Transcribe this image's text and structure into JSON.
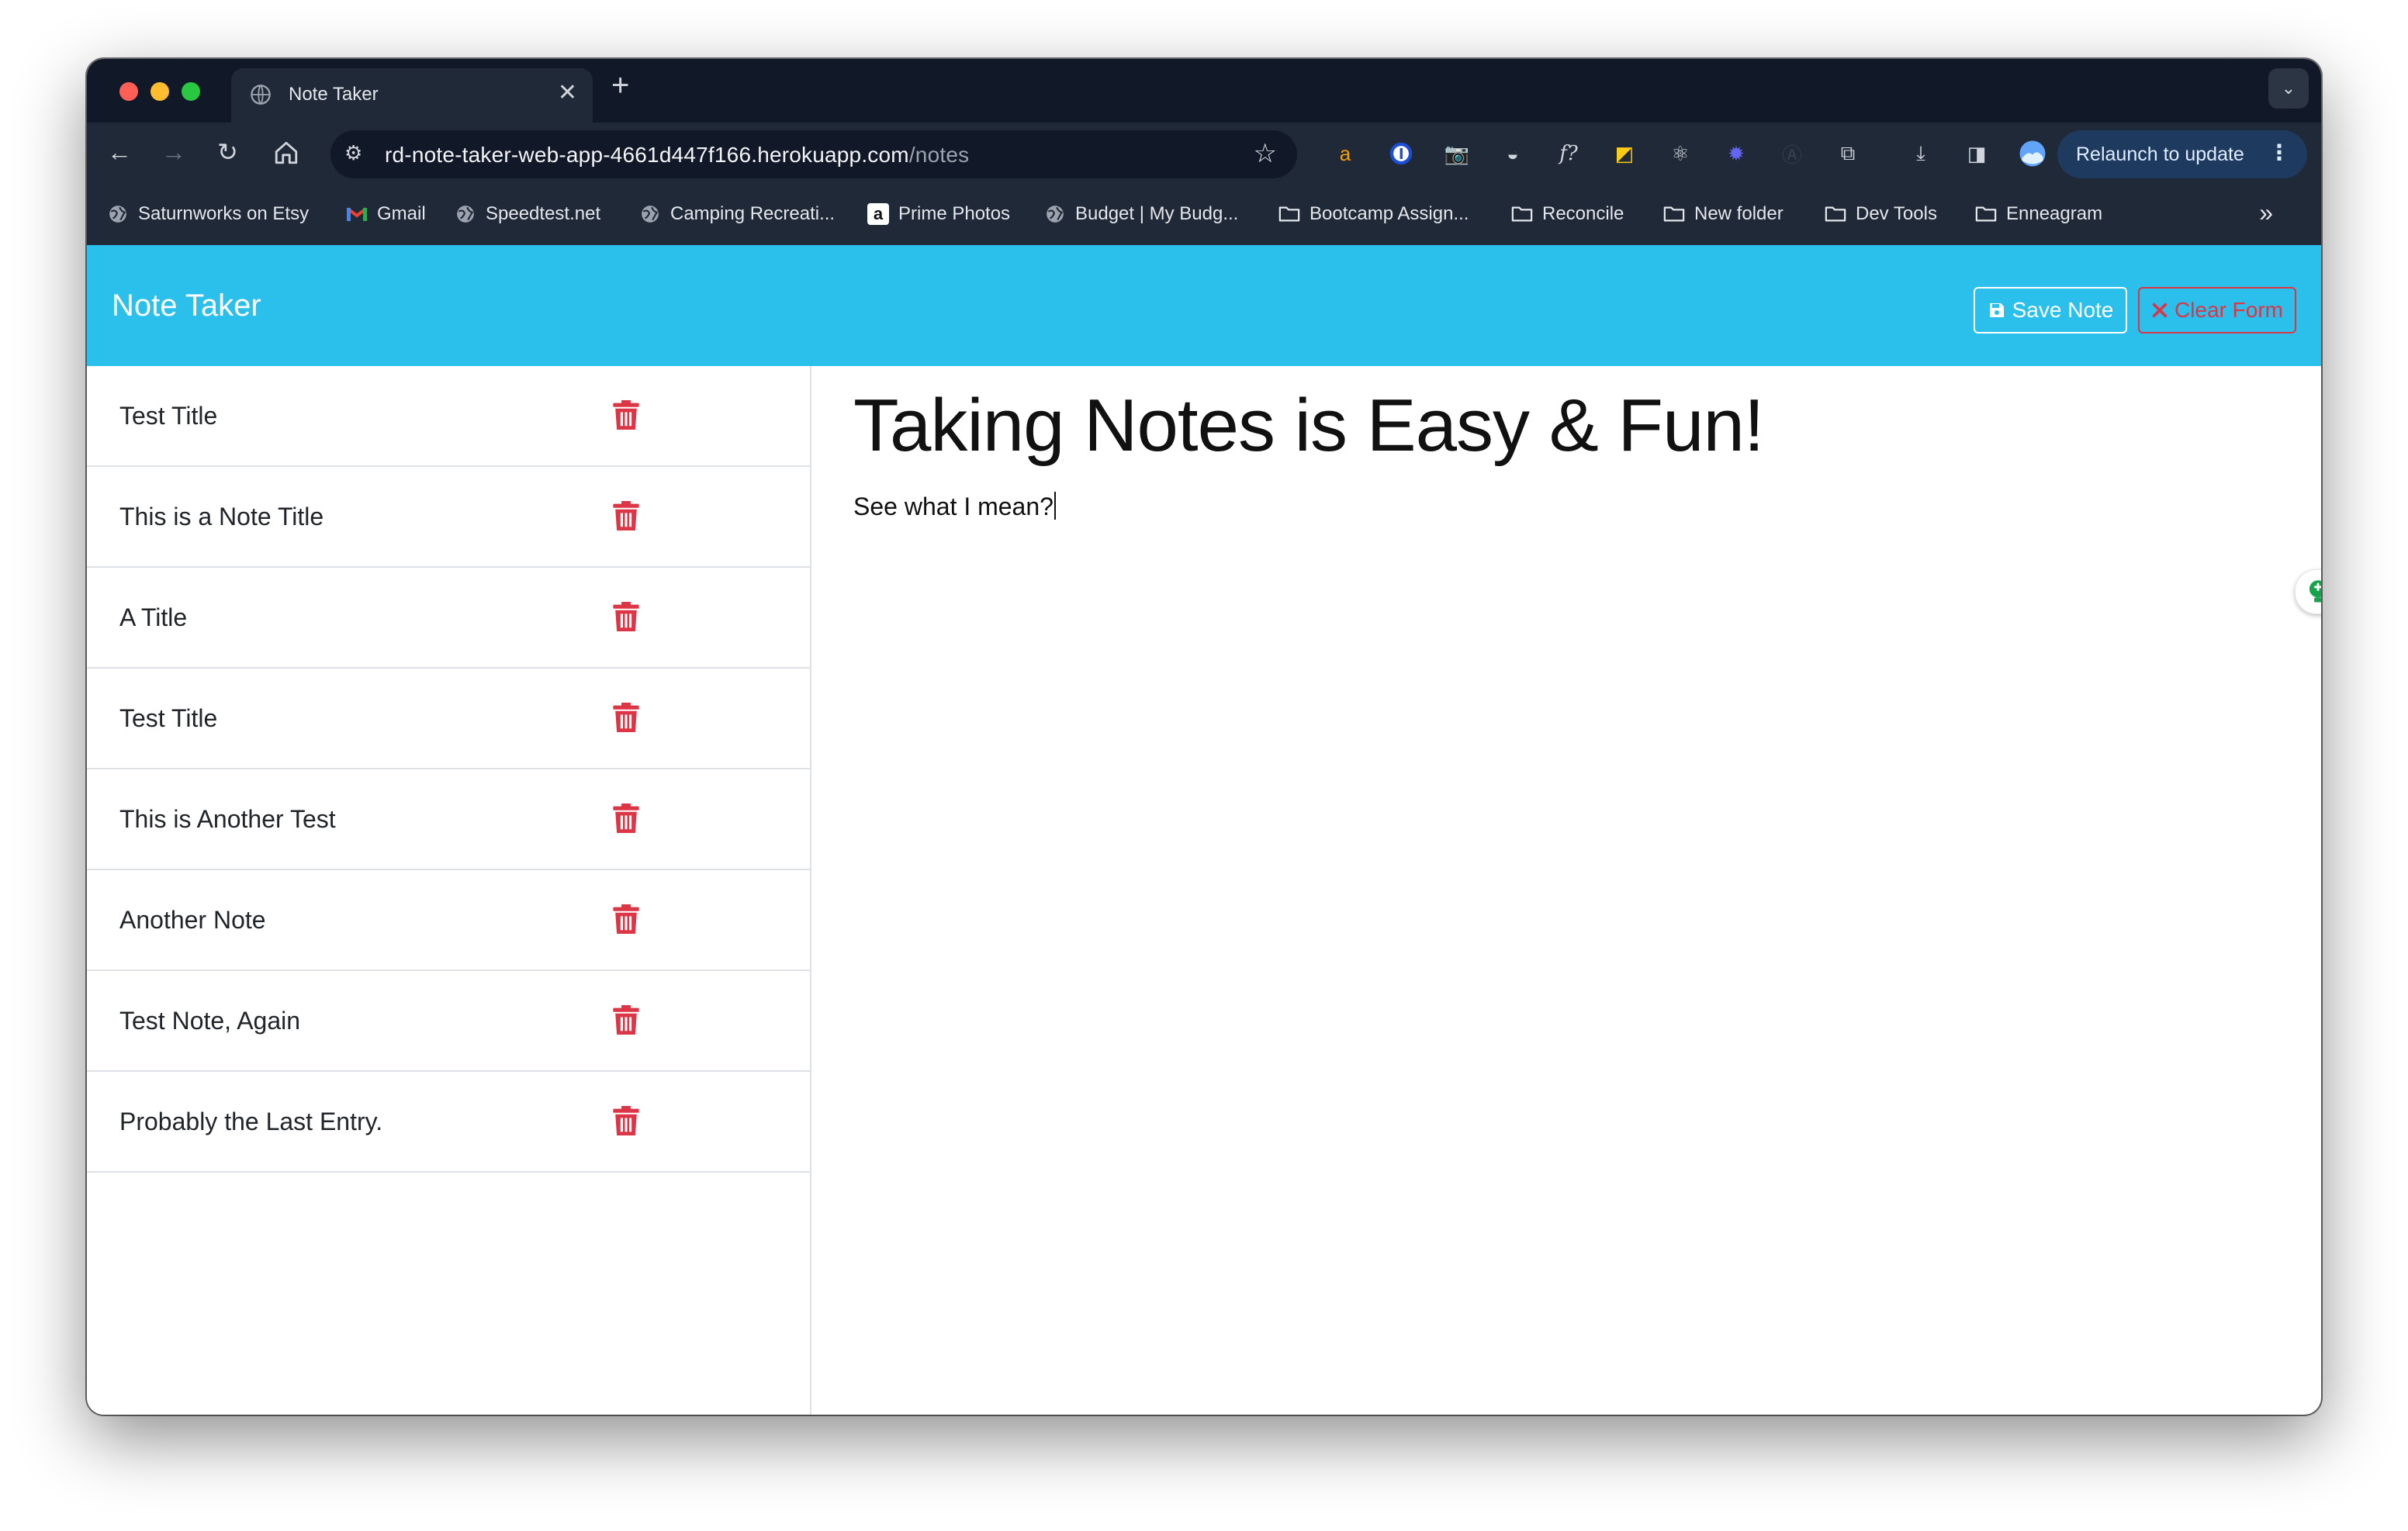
{
  "browser": {
    "tab_title": "Note Taker",
    "tab_close": "✕",
    "new_tab": "+",
    "url_host": "rd-note-taker-web-app-4661d447f166.herokuapp.com",
    "url_path": "/notes",
    "relaunch_label": "Relaunch to update",
    "bookmarks": [
      {
        "label": "Saturnworks on Etsy",
        "icon": "globe-icon"
      },
      {
        "label": "Gmail",
        "icon": "gmail-icon"
      },
      {
        "label": "Speedtest.net",
        "icon": "globe-icon"
      },
      {
        "label": "Camping Recreati...",
        "icon": "globe-icon"
      },
      {
        "label": "Prime Photos",
        "icon": "amazon-icon"
      },
      {
        "label": "Budget | My Budg...",
        "icon": "globe-icon"
      },
      {
        "label": "Bootcamp Assign...",
        "icon": "folder-icon"
      },
      {
        "label": "Reconcile",
        "icon": "folder-icon"
      },
      {
        "label": "New folder",
        "icon": "folder-icon"
      },
      {
        "label": "Dev Tools",
        "icon": "folder-icon"
      },
      {
        "label": "Enneagram",
        "icon": "folder-icon"
      }
    ],
    "extension_icons": [
      "amazon-icon",
      "password-manager-icon",
      "camera-icon",
      "turtle-icon",
      "font-icon",
      "color-picker-icon",
      "react-icon",
      "gear-purple-icon",
      "a-icon",
      "extensions-icon",
      "download-icon",
      "side-panel-icon",
      "profile-icon"
    ]
  },
  "app": {
    "brand": "Note Taker",
    "save_label": "Save Note",
    "clear_label": "Clear Form",
    "notes": [
      {
        "title": "Test Title"
      },
      {
        "title": "This is a Note Title"
      },
      {
        "title": "A Title"
      },
      {
        "title": "Test Title"
      },
      {
        "title": "This is Another Test"
      },
      {
        "title": "Another Note"
      },
      {
        "title": "Test Note, Again"
      },
      {
        "title": "Probably the Last Entry."
      }
    ],
    "active_note": {
      "title": "Taking Notes is Easy & Fun!",
      "text": "See what I mean?"
    }
  },
  "colors": {
    "nav": "#2bbfec",
    "danger": "#dc3545",
    "chrome_dark": "#111827",
    "chrome_toolbar": "#1f2937"
  }
}
